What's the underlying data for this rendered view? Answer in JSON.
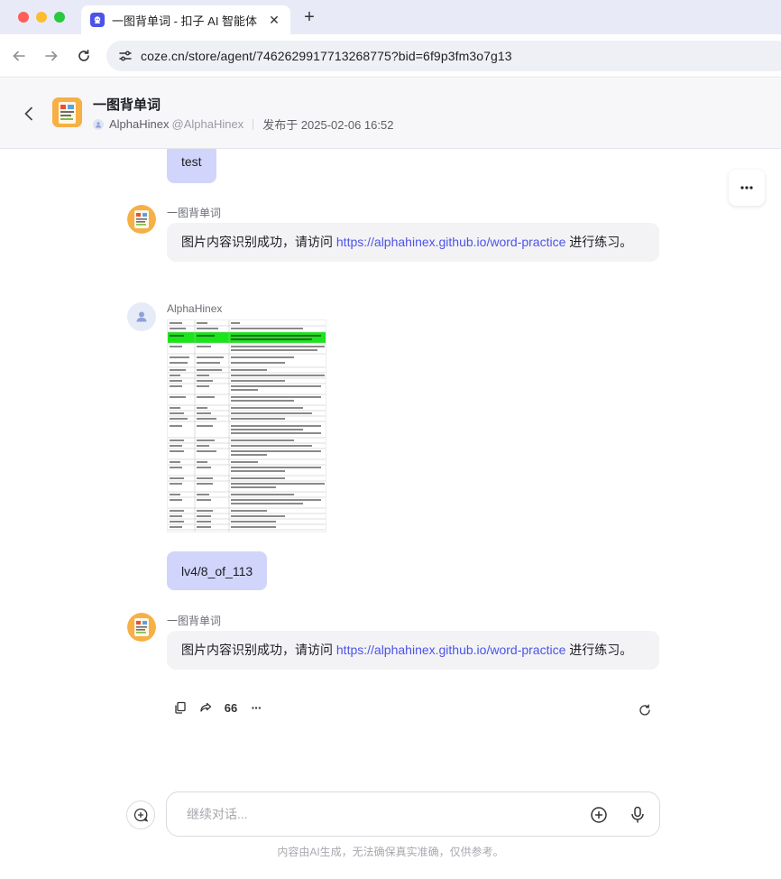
{
  "browser": {
    "tab_title": "一图背单词 - 扣子 AI 智能体",
    "url": "coze.cn/store/agent/7462629917713268775?bid=6f9p3fm3o7g13",
    "icons": [
      "back-arrow-icon",
      "forward-arrow-icon",
      "reload-icon",
      "site-settings-icon",
      "close-icon",
      "plus-icon"
    ],
    "traffic_colors": [
      "#ff5f57",
      "#febc2e",
      "#28c840"
    ]
  },
  "header": {
    "bot_name": "一图背单词",
    "author": "AlphaHinex",
    "handle": "@AlphaHinex",
    "published": "发布于 2025-02-06 16:52"
  },
  "messages": {
    "m1_text": "test",
    "m2_sender": "一图背单词",
    "m2_prefix": "图片内容识别成功，请访问 ",
    "m2_link": "https://alphahinex.github.io/word-practice",
    "m2_suffix": " 进行练习。",
    "m3_sender": "AlphaHinex",
    "m3_caption": "lv4/8_of_113",
    "m4_sender": "一图背单词",
    "m4_prefix": "图片内容识别成功，请访问 ",
    "m4_link": "https://alphahinex.github.io/word-practice",
    "m4_suffix": " 进行练习。"
  },
  "actions": {
    "icons": [
      "copy-icon",
      "share-icon",
      "quote-icon",
      "more-dots-icon",
      "regenerate-icon"
    ],
    "quote_glyph": "66",
    "more_glyph": "···"
  },
  "composer": {
    "placeholder": "继续对话...",
    "disclaimer": "内容由AI生成，无法确保真实准确，仅供参考。"
  },
  "colors": {
    "accent": "#4d53e8",
    "user_bubble": "#d1d5fb",
    "bot_bubble": "#f3f3f6",
    "highlight_green": "#19e619"
  }
}
